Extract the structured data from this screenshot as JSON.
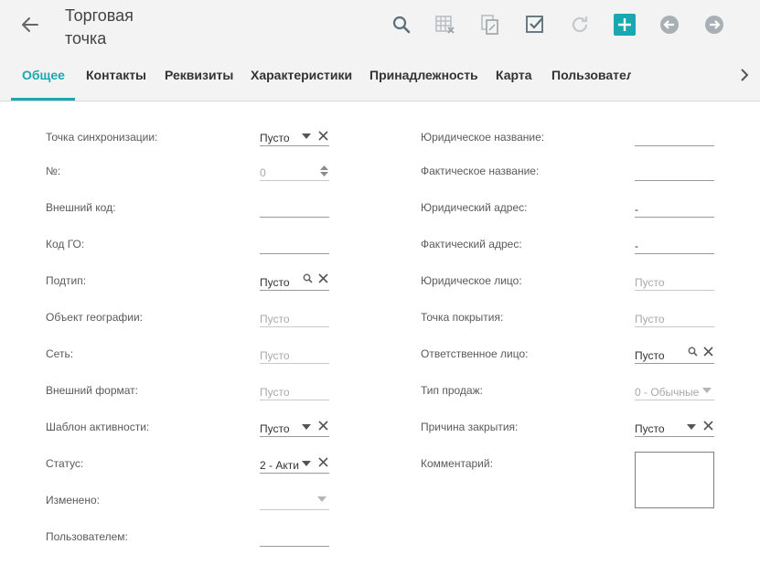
{
  "header": {
    "title": "Торговая точка",
    "back_icon": "arrow-left-icon",
    "toolbar": [
      {
        "name": "search-button",
        "icon": "search-icon"
      },
      {
        "name": "table-delete-button",
        "icon": "table-x-icon"
      },
      {
        "name": "copy-button",
        "icon": "copy-icon"
      },
      {
        "name": "save-check-button",
        "icon": "checkbox-check-icon"
      },
      {
        "name": "refresh-button",
        "icon": "refresh-icon"
      },
      {
        "name": "add-button",
        "icon": "plus-icon"
      },
      {
        "name": "prev-button",
        "icon": "arrow-circle-left-icon"
      },
      {
        "name": "next-button",
        "icon": "arrow-circle-right-icon"
      }
    ],
    "accent_color": "#19a8b0"
  },
  "tabs": [
    {
      "label": "Общее",
      "active": true
    },
    {
      "label": "Контакты"
    },
    {
      "label": "Реквизиты"
    },
    {
      "label": "Характеристики"
    },
    {
      "label": "Принадлежность"
    },
    {
      "label": "Карта"
    },
    {
      "label": "Пользовател"
    }
  ],
  "left_fields": [
    {
      "label": "Точка синхронизации:",
      "value": "Пусто",
      "placeholder": false,
      "controls": [
        "dropdown",
        "clear"
      ]
    },
    {
      "label": "№:",
      "value": "0",
      "placeholder": true,
      "controls": [
        "spinner"
      ]
    },
    {
      "label": "Внешний код:",
      "value": "",
      "controls": []
    },
    {
      "label": "Код ГО:",
      "value": "",
      "controls": []
    },
    {
      "label": "Подтип:",
      "value": "Пусто",
      "placeholder": false,
      "controls": [
        "search",
        "clear"
      ]
    },
    {
      "label": "Объект географии:",
      "value": "Пусто",
      "placeholder": true,
      "controls": []
    },
    {
      "label": "Сеть:",
      "value": "Пусто",
      "placeholder": true,
      "controls": []
    },
    {
      "label": "Внешний формат:",
      "value": "Пусто",
      "placeholder": true,
      "controls": []
    },
    {
      "label": "Шаблон активности:",
      "value": "Пусто",
      "placeholder": false,
      "controls": [
        "dropdown",
        "clear"
      ]
    },
    {
      "label": "Статус:",
      "value": "2 - Акти",
      "placeholder": false,
      "controls": [
        "dropdown",
        "clear"
      ]
    },
    {
      "label": "Изменено:",
      "value": "",
      "controls": [
        "dropdown-disabled"
      ]
    },
    {
      "label": "Пользователем:",
      "value": "",
      "controls": []
    }
  ],
  "right_fields": [
    {
      "label": "Юридическое название:",
      "value": "",
      "controls": []
    },
    {
      "label": "Фактическое название:",
      "value": "",
      "controls": []
    },
    {
      "label": "Юридический адрес:",
      "value": "-",
      "placeholder": false,
      "controls": []
    },
    {
      "label": "Фактический адрес:",
      "value": "-",
      "placeholder": false,
      "controls": []
    },
    {
      "label": "Юридическое лицо:",
      "value": "Пусто",
      "placeholder": true,
      "controls": []
    },
    {
      "label": "Точка покрытия:",
      "value": "Пусто",
      "placeholder": true,
      "controls": []
    },
    {
      "label": "Ответственное лицо:",
      "value": "Пусто",
      "placeholder": false,
      "controls": [
        "search",
        "clear"
      ]
    },
    {
      "label": "Тип продаж:",
      "value": "0 - Обычные",
      "placeholder": true,
      "controls": [
        "dropdown-disabled"
      ]
    },
    {
      "label": "Причина закрытия:",
      "value": "Пусто",
      "placeholder": false,
      "controls": [
        "dropdown",
        "clear"
      ]
    },
    {
      "label": "Комментарий:",
      "value": "",
      "controls": [
        "textarea"
      ]
    }
  ]
}
